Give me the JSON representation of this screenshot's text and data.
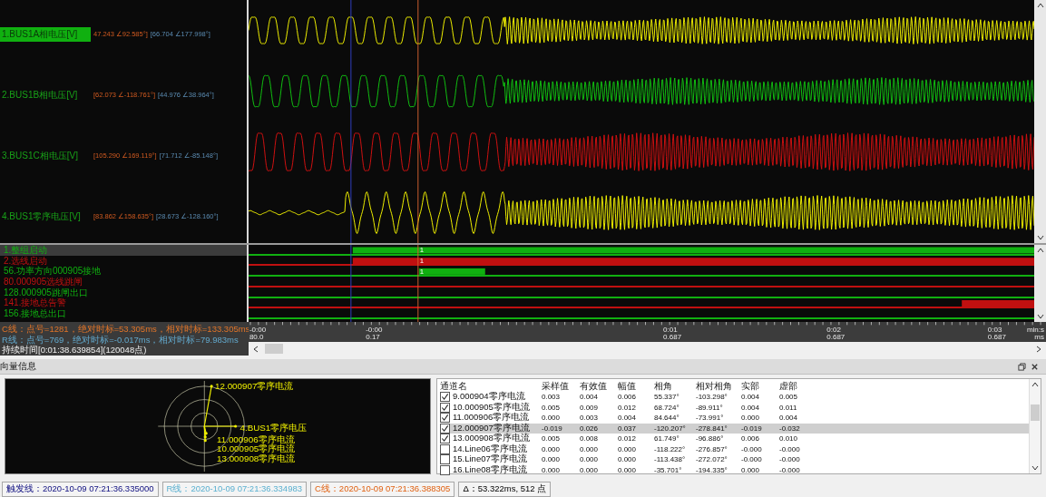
{
  "analog_channels": [
    {
      "name": "1.BUS1A相电压[V]",
      "value_1": "47.243 ∠92.585°]",
      "value_2": "[66.704 ∠177.998°]",
      "color": "#f0f000",
      "selected": true
    },
    {
      "name": "2.BUS1B相电压[V]",
      "value_1": "[62.073 ∠-118.761°]",
      "value_2": "[44.976 ∠38.964°]",
      "color": "#10c010",
      "selected": false
    },
    {
      "name": "3.BUS1C相电压[V]",
      "value_1": "[105.290 ∠169.119°]",
      "value_2": "[71.712 ∠-85.148°]",
      "color": "#d01010",
      "selected": false
    },
    {
      "name": "4.BUS1零序电压[V]",
      "value_1": "[83.862 ∠158.635°]",
      "value_2": "[28.673 ∠-128.160°]",
      "color": "#f0f000",
      "selected": false
    }
  ],
  "digital_channels": [
    {
      "label": "1.整组启动",
      "color": "#10b010",
      "selected": true,
      "active": true,
      "cursor_value": "1"
    },
    {
      "label": "2.选线启动",
      "color": "#c01010",
      "selected": false,
      "active": true,
      "cursor_value": "1"
    },
    {
      "label": "56.功率方向000905接地",
      "color": "#10b010",
      "selected": false,
      "active": true,
      "cursor_value": "1"
    },
    {
      "label": "80.000905选线跳闸",
      "color": "#c01010",
      "selected": false,
      "active": false
    },
    {
      "label": "128.000905跳闸出口",
      "color": "#10b010",
      "selected": false,
      "active": false
    },
    {
      "label": "141.接地总告警",
      "color": "#c01010",
      "selected": false,
      "active": true
    },
    {
      "label": "156.接地总出口",
      "color": "#10b010",
      "selected": false,
      "active": false
    }
  ],
  "cursor_info": [
    {
      "kind": "c_line",
      "text": "C线：点号=1281，绝对时标=53.305ms，相对时标=133.305ms"
    },
    {
      "kind": "r_line",
      "text": "R线：点号=769，绝对时标=-0.017ms，相对时标=79.983ms"
    },
    {
      "kind": "duration",
      "text": "持续时间[0:01:38.639854](120048点)"
    }
  ],
  "time_axis": {
    "ticks": [
      {
        "time": "-0:00",
        "ms": "80.0"
      },
      {
        "time": "-0:00",
        "ms": "0.17"
      },
      {
        "time": "0:01",
        "ms": "0.687"
      },
      {
        "time": "0:02",
        "ms": "0.687"
      },
      {
        "time": "0:03",
        "ms": "0.687"
      }
    ],
    "unit_time": "min:s",
    "unit_ms": "ms"
  },
  "vector_panel": {
    "title": "向量信息",
    "vectors": [
      {
        "label": "12.000907零序电流"
      },
      {
        "label": "4.BUS1零序电压"
      },
      {
        "label": "11.000906零序电流"
      },
      {
        "label": "10.000905零序电流"
      },
      {
        "label": "13.000908零序电流"
      }
    ]
  },
  "table": {
    "columns": [
      "通道名",
      "采样值",
      "有效值",
      "幅值",
      "相角",
      "相对相角",
      "实部",
      "虚部"
    ],
    "rows": [
      {
        "checked": true,
        "selected": false,
        "cells": [
          "9.000904零序电流",
          "0.003",
          "0.004",
          "0.006",
          "55.337°",
          "-103.298°",
          "0.004",
          "0.005"
        ]
      },
      {
        "checked": true,
        "selected": false,
        "cells": [
          "10.000905零序电流",
          "0.005",
          "0.009",
          "0.012",
          "68.724°",
          "-89.911°",
          "0.004",
          "0.011"
        ]
      },
      {
        "checked": true,
        "selected": false,
        "cells": [
          "11.000906零序电流",
          "0.000",
          "0.003",
          "0.004",
          "84.644°",
          "-73.991°",
          "0.000",
          "0.004"
        ]
      },
      {
        "checked": true,
        "selected": true,
        "cells": [
          "12.000907零序电流",
          "-0.019",
          "0.026",
          "0.037",
          "-120.207°",
          "-278.841°",
          "-0.019",
          "-0.032"
        ]
      },
      {
        "checked": true,
        "selected": false,
        "cells": [
          "13.000908零序电流",
          "0.005",
          "0.008",
          "0.012",
          "61.749°",
          "-96.886°",
          "0.006",
          "0.010"
        ]
      },
      {
        "checked": false,
        "selected": false,
        "cells": [
          "14.Line06零序电流",
          "0.000",
          "0.000",
          "0.000",
          "-118.222°",
          "-276.857°",
          "-0.000",
          "-0.000"
        ]
      },
      {
        "checked": false,
        "selected": false,
        "cells": [
          "15.Line07零序电流",
          "0.000",
          "0.000",
          "0.000",
          "-113.438°",
          "-272.072°",
          "-0.000",
          "-0.000"
        ]
      },
      {
        "checked": false,
        "selected": false,
        "cells": [
          "16.Line08零序电流",
          "0.000",
          "0.000",
          "0.000",
          "-35.701°",
          "-194.335°",
          "0.000",
          "-0.000"
        ]
      }
    ]
  },
  "status_bar": [
    {
      "kind": "trigger",
      "text": "触发线：2020-10-09 07:21:36.335000"
    },
    {
      "kind": "r_line",
      "text": "R线：2020-10-09 07:21:36.334983"
    },
    {
      "kind": "c_line",
      "text": "C线：2020-10-09 07:21:36.388305"
    },
    {
      "kind": "delta",
      "text": "Δ：53.322ms, 512 点"
    }
  ]
}
